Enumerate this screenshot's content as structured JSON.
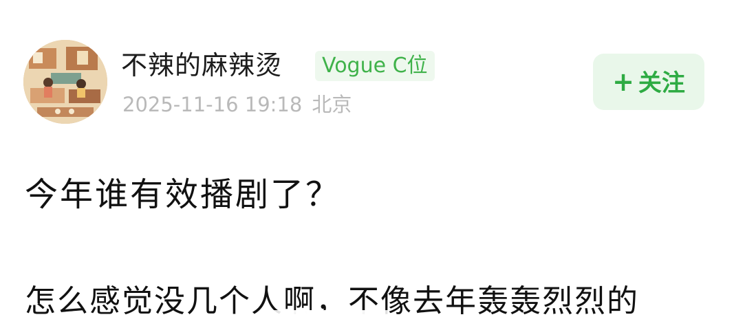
{
  "post": {
    "author": {
      "name": "不辣的麻辣烫",
      "badge": "Vogue C位",
      "avatar": "illustrated-room-avatar"
    },
    "meta": {
      "timestamp": "2025-11-16 19:18",
      "location": "北京"
    },
    "follow_button": {
      "icon": "+",
      "label": "关注"
    },
    "title": "今年谁有效播剧了？",
    "text": "怎么感觉没几个人啊，不像去年轰轰烈烈的"
  },
  "colors": {
    "accent_green": "#2eab43",
    "badge_background": "#eef8ee",
    "follow_background": "#e9f7ea",
    "meta_gray": "#b9b9b9"
  }
}
